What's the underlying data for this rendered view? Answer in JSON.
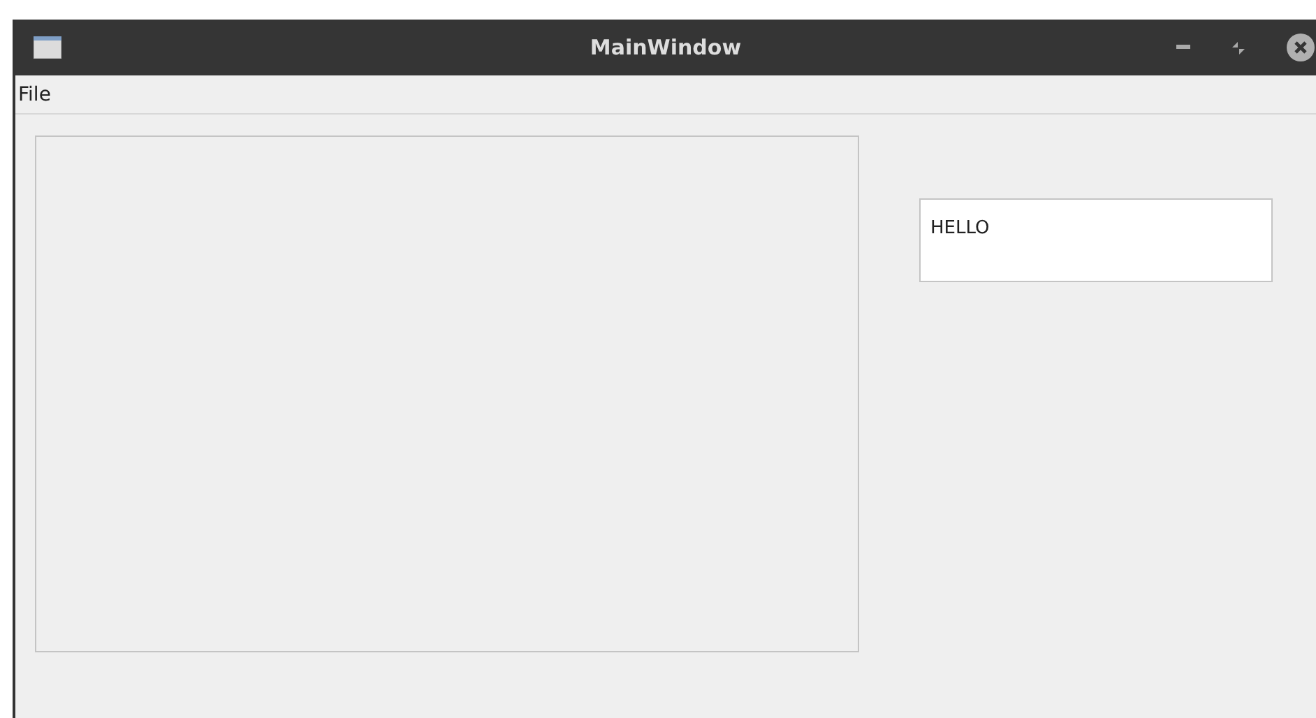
{
  "window": {
    "title": "MainWindow"
  },
  "menu": [
    "File"
  ],
  "text_box": {
    "value": "HELLO"
  }
}
